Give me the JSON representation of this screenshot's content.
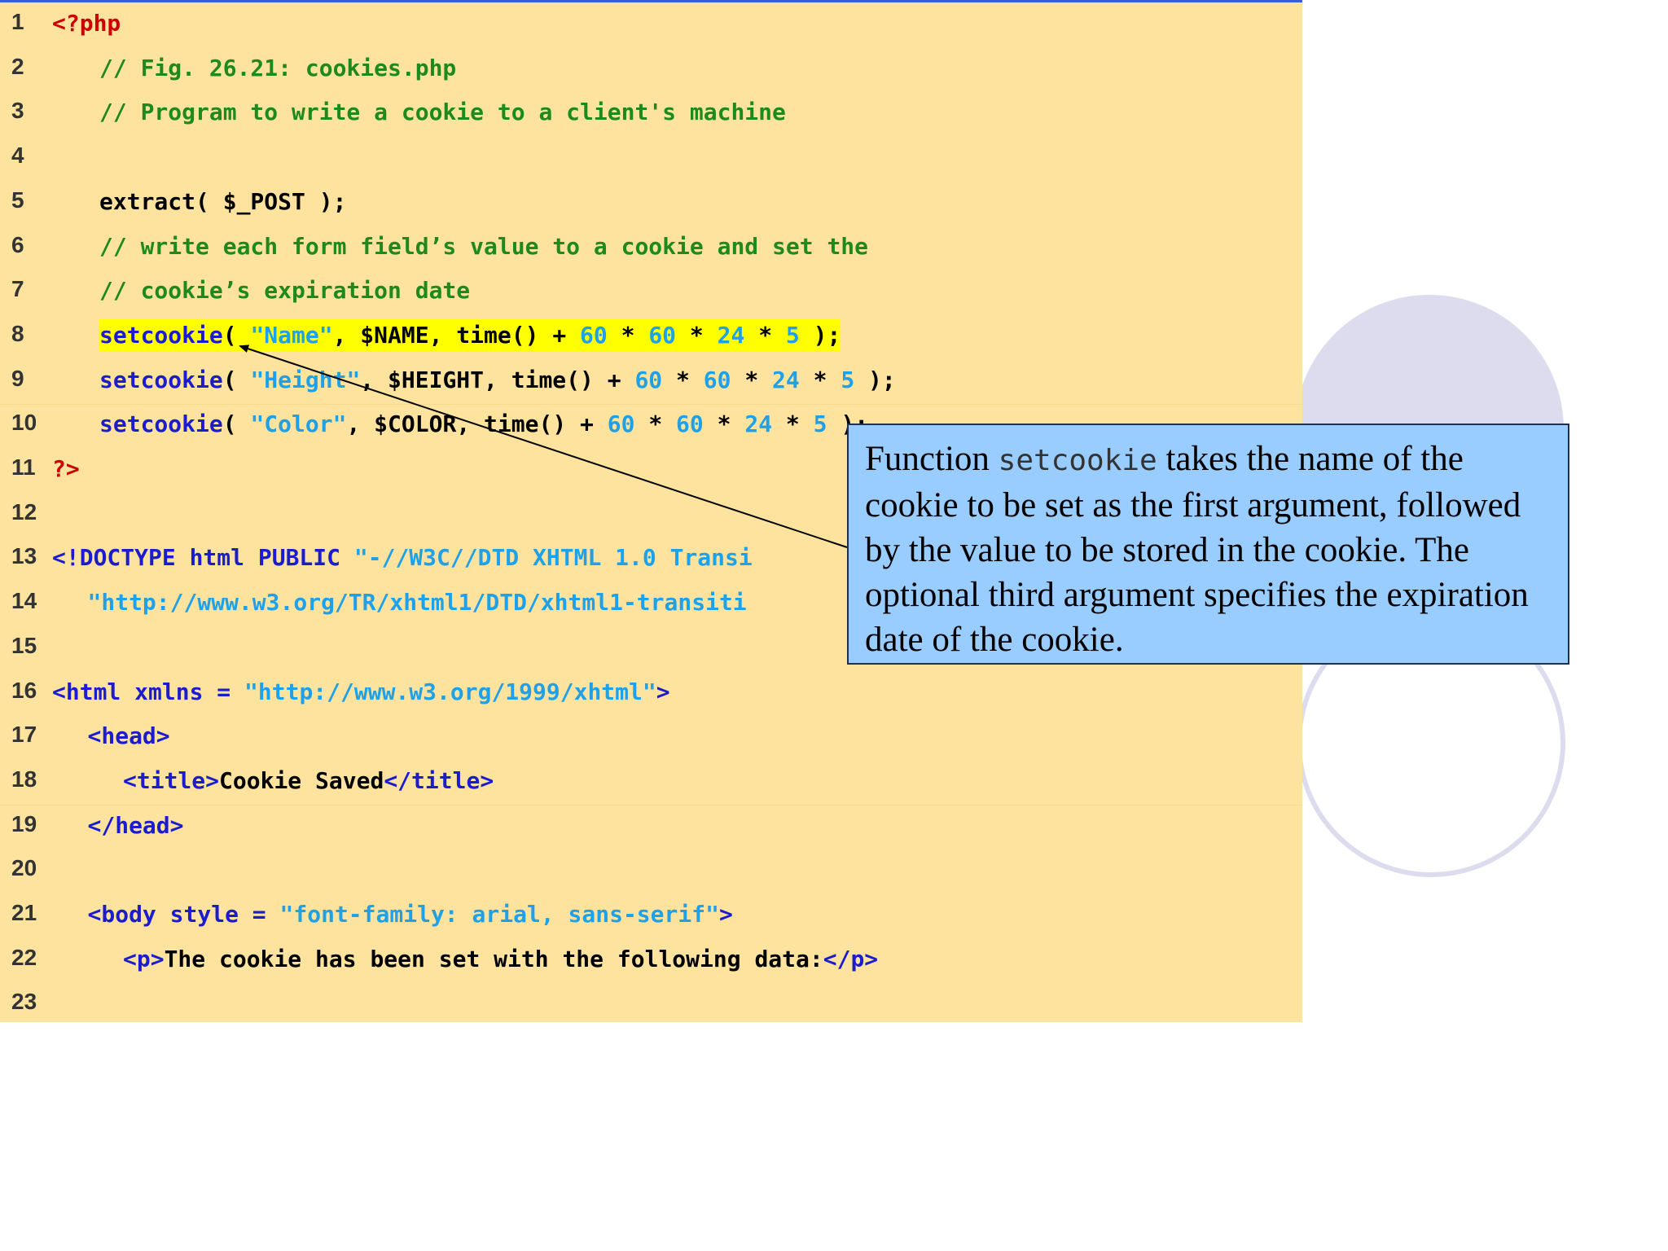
{
  "code": {
    "lines": [
      {
        "n": "1",
        "indent": 0,
        "segments": [
          {
            "t": "<?php",
            "c": "red"
          }
        ]
      },
      {
        "n": "2",
        "indent": 4,
        "segments": [
          {
            "t": "// Fig. 26.21: cookies.php",
            "c": "green"
          }
        ]
      },
      {
        "n": "3",
        "indent": 4,
        "segments": [
          {
            "t": "// Program to write a cookie to a client's machine",
            "c": "green"
          }
        ]
      },
      {
        "n": "4",
        "indent": 0,
        "segments": []
      },
      {
        "n": "5",
        "indent": 4,
        "segments": [
          {
            "t": "extract( $_POST );",
            "c": "black"
          }
        ]
      },
      {
        "n": "6",
        "indent": 4,
        "segments": [
          {
            "t": "// write each form field’s value to a cookie and set the",
            "c": "green"
          }
        ]
      },
      {
        "n": "7",
        "indent": 4,
        "segments": [
          {
            "t": "// cookie’s expiration date",
            "c": "green"
          }
        ]
      },
      {
        "n": "8",
        "indent": 4,
        "highlight": true,
        "segments": [
          {
            "t": "setcookie",
            "c": "blue"
          },
          {
            "t": "( ",
            "c": "black"
          },
          {
            "t": "\"Name\"",
            "c": "cyan"
          },
          {
            "t": ", $NAME, time() + ",
            "c": "black"
          },
          {
            "t": "60",
            "c": "cyan"
          },
          {
            "t": " * ",
            "c": "black"
          },
          {
            "t": "60",
            "c": "cyan"
          },
          {
            "t": " * ",
            "c": "black"
          },
          {
            "t": "24",
            "c": "cyan"
          },
          {
            "t": " * ",
            "c": "black"
          },
          {
            "t": "5",
            "c": "cyan"
          },
          {
            "t": " );",
            "c": "black"
          }
        ]
      },
      {
        "n": "9",
        "indent": 4,
        "segments": [
          {
            "t": "setcookie",
            "c": "blue"
          },
          {
            "t": "( ",
            "c": "black"
          },
          {
            "t": "\"Height\"",
            "c": "cyan"
          },
          {
            "t": ", $HEIGHT, time() + ",
            "c": "black"
          },
          {
            "t": "60",
            "c": "cyan"
          },
          {
            "t": " * ",
            "c": "black"
          },
          {
            "t": "60",
            "c": "cyan"
          },
          {
            "t": " * ",
            "c": "black"
          },
          {
            "t": "24",
            "c": "cyan"
          },
          {
            "t": " * ",
            "c": "black"
          },
          {
            "t": "5",
            "c": "cyan"
          },
          {
            "t": " );",
            "c": "black"
          }
        ]
      },
      {
        "n": "10",
        "indent": 4,
        "segments": [
          {
            "t": "setcookie",
            "c": "blue"
          },
          {
            "t": "( ",
            "c": "black"
          },
          {
            "t": "\"Color\"",
            "c": "cyan"
          },
          {
            "t": ", $COLOR, time() + ",
            "c": "black"
          },
          {
            "t": "60",
            "c": "cyan"
          },
          {
            "t": " * ",
            "c": "black"
          },
          {
            "t": "60",
            "c": "cyan"
          },
          {
            "t": " * ",
            "c": "black"
          },
          {
            "t": "24",
            "c": "cyan"
          },
          {
            "t": " * ",
            "c": "black"
          },
          {
            "t": "5",
            "c": "cyan"
          },
          {
            "t": " );",
            "c": "black"
          }
        ]
      },
      {
        "n": "11",
        "indent": 0,
        "segments": [
          {
            "t": "?>",
            "c": "red"
          }
        ]
      },
      {
        "n": "12",
        "indent": 0,
        "segments": []
      },
      {
        "n": "13",
        "indent": 0,
        "segments": [
          {
            "t": "<!DOCTYPE html PUBLIC ",
            "c": "blue"
          },
          {
            "t": "\"-//W3C//DTD XHTML 1.0 Transi",
            "c": "cyan"
          }
        ]
      },
      {
        "n": "14",
        "indent": 3,
        "segments": [
          {
            "t": "\"http://www.w3.org/TR/xhtml1/DTD/xhtml1-transiti",
            "c": "cyan"
          }
        ]
      },
      {
        "n": "15",
        "indent": 0,
        "segments": []
      },
      {
        "n": "16",
        "indent": 0,
        "segments": [
          {
            "t": "<html xmlns = ",
            "c": "blue"
          },
          {
            "t": "\"http://www.w3.org/1999/xhtml\"",
            "c": "cyan"
          },
          {
            "t": ">",
            "c": "blue"
          }
        ]
      },
      {
        "n": "17",
        "indent": 3,
        "segments": [
          {
            "t": "<head>",
            "c": "blue"
          }
        ]
      },
      {
        "n": "18",
        "indent": 6,
        "segments": [
          {
            "t": "<title>",
            "c": "blue"
          },
          {
            "t": "Cookie Saved",
            "c": "black"
          },
          {
            "t": "</title>",
            "c": "blue"
          }
        ]
      },
      {
        "n": "19",
        "indent": 3,
        "segments": [
          {
            "t": "</head>",
            "c": "blue"
          }
        ]
      },
      {
        "n": "20",
        "indent": 0,
        "segments": []
      },
      {
        "n": "21",
        "indent": 3,
        "segments": [
          {
            "t": "<body style = ",
            "c": "blue"
          },
          {
            "t": "\"font-family: arial, sans-serif\"",
            "c": "cyan"
          },
          {
            "t": ">",
            "c": "blue"
          }
        ]
      },
      {
        "n": "22",
        "indent": 6,
        "segments": [
          {
            "t": "<p>",
            "c": "blue"
          },
          {
            "t": "The cookie has been set with the following data:",
            "c": "black"
          },
          {
            "t": "</p>",
            "c": "blue"
          }
        ]
      },
      {
        "n": "23",
        "indent": 0,
        "segments": []
      }
    ]
  },
  "callout": {
    "text_before": "Function ",
    "function_name": "setcookie",
    "text_after": " takes the name of the cookie to be set as the first argument, followed by the value to be stored in the cookie. The optional third argument specifies the expiration date of the cookie."
  },
  "colors": {
    "code_background": "#fee39f",
    "highlight": "#ffff00",
    "callout_background": "#99ccff",
    "keyword_blue": "#1c1ccf",
    "string_cyan": "#1ea1e8",
    "comment_green": "#1e8a1e",
    "php_tag_red": "#cc0000"
  }
}
